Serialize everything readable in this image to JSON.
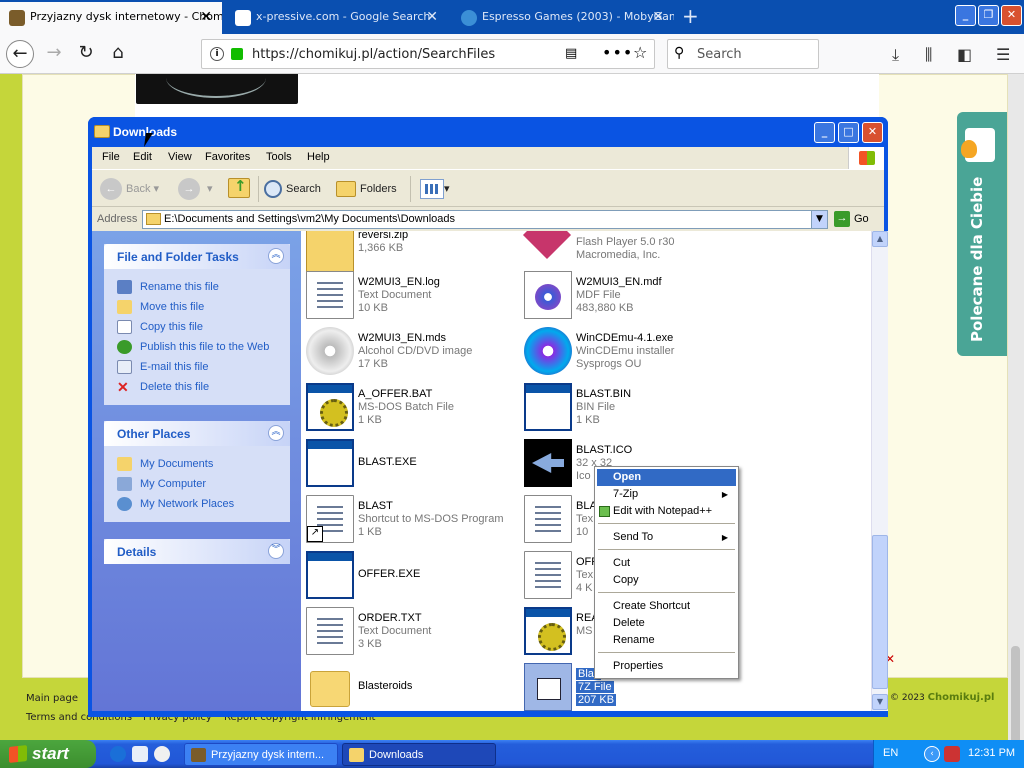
{
  "browser": {
    "tabs": [
      {
        "title": "Przyjazny dysk internetowy - Chomikuj.pl",
        "active": true,
        "favicon_color": "#7a5c2a"
      },
      {
        "title": "x-pressive.com - Google Search",
        "active": false,
        "favicon_color": "#4285f4"
      },
      {
        "title": "Espresso Games (2003) - MobyGames",
        "active": false,
        "favicon_color": "#3b8fd6"
      }
    ],
    "url": "https://chomikuj.pl/action/SearchFiles",
    "search_placeholder": "Search"
  },
  "website": {
    "footer_links": [
      "Main page",
      "Terms and conditions",
      "Privacy policy",
      "Report copyright infringement"
    ],
    "copyright": "© 2023",
    "brand": "Chomikuj.pl",
    "side_tab": "Polecane dla Ciebie"
  },
  "explorer": {
    "title": "Downloads",
    "menu": [
      "File",
      "Edit",
      "View",
      "Favorites",
      "Tools",
      "Help"
    ],
    "toolbar": {
      "back": "Back",
      "search": "Search",
      "folders": "Folders"
    },
    "address_label": "Address",
    "address": "E:\\Documents and Settings\\vm2\\My Documents\\Downloads",
    "go": "Go",
    "file_tasks": {
      "title": "File and Folder Tasks",
      "items": [
        {
          "label": "Rename this file",
          "icon": "rename-icon"
        },
        {
          "label": "Move this file",
          "icon": "move-icon"
        },
        {
          "label": "Copy this file",
          "icon": "copy-icon"
        },
        {
          "label": "Publish this file to the Web",
          "icon": "globe-icon"
        },
        {
          "label": "E-mail this file",
          "icon": "email-icon"
        },
        {
          "label": "Delete this file",
          "icon": "delete-icon"
        }
      ]
    },
    "other_places": {
      "title": "Other Places",
      "items": [
        {
          "label": "My Documents",
          "icon": "folder-icon"
        },
        {
          "label": "My Computer",
          "icon": "computer-icon"
        },
        {
          "label": "My Network Places",
          "icon": "network-icon"
        }
      ]
    },
    "details": {
      "title": "Details"
    },
    "files_left": [
      {
        "name": "reversi.zip",
        "type": "",
        "size": "1,366 KB",
        "icon": "zip"
      },
      {
        "name": "W2MUI3_EN.log",
        "type": "Text Document",
        "size": "10 KB",
        "icon": "doc"
      },
      {
        "name": "W2MUI3_EN.mds",
        "type": "Alcohol CD/DVD image",
        "size": "17 KB",
        "icon": "cd"
      },
      {
        "name": "A_OFFER.BAT",
        "type": "MS-DOS Batch File",
        "size": "1 KB",
        "icon": "bat"
      },
      {
        "name": "BLAST.EXE",
        "type": "",
        "size": "",
        "icon": "window"
      },
      {
        "name": "BLAST",
        "type": "Shortcut to MS-DOS Program",
        "size": "1 KB",
        "icon": "shortcut"
      },
      {
        "name": "OFFER.EXE",
        "type": "",
        "size": "",
        "icon": "window"
      },
      {
        "name": "ORDER.TXT",
        "type": "Text Document",
        "size": "3 KB",
        "icon": "doc"
      },
      {
        "name": "Blasteroids",
        "type": "",
        "size": "",
        "icon": "folder"
      }
    ],
    "files_right": [
      {
        "name": "",
        "type": "Flash Player 5.0 r30",
        "size": "Macromedia, Inc.",
        "icon": "flash"
      },
      {
        "name": "W2MUI3_EN.mdf",
        "type": "MDF File",
        "size": "483,880 KB",
        "icon": "mdf"
      },
      {
        "name": "WinCDEmu-4.1.exe",
        "type": "WinCDEmu installer",
        "size": "Sysprogs OU",
        "icon": "disc"
      },
      {
        "name": "BLAST.BIN",
        "type": "BIN File",
        "size": "1 KB",
        "icon": "window"
      },
      {
        "name": "BLAST.ICO",
        "type": "32 x 32",
        "size": "Ico",
        "icon": "ico"
      },
      {
        "name": "BLA",
        "type": "Tex",
        "size": "10",
        "icon": "doc"
      },
      {
        "name": "OFF",
        "type": "Tex",
        "size": "4 K",
        "icon": "doc"
      },
      {
        "name": "REA",
        "type": "MS",
        "size": "",
        "icon": "bat"
      },
      {
        "name": "Blas",
        "type": "7Z File",
        "size": "207 KB",
        "icon": "7z",
        "selected": true
      }
    ]
  },
  "context_menu": {
    "items": [
      {
        "label": "Open",
        "highlighted": true
      },
      {
        "label": "7-Zip",
        "submenu": true
      },
      {
        "label": "Edit with Notepad++",
        "icon": true
      },
      {
        "separator": true
      },
      {
        "label": "Send To",
        "submenu": true
      },
      {
        "separator": true
      },
      {
        "label": "Cut"
      },
      {
        "label": "Copy"
      },
      {
        "separator": true
      },
      {
        "label": "Create Shortcut"
      },
      {
        "label": "Delete"
      },
      {
        "label": "Rename"
      },
      {
        "separator": true
      },
      {
        "label": "Properties"
      }
    ]
  },
  "taskbar": {
    "start": "start",
    "tasks": [
      {
        "label": "Przyjazny dysk intern...",
        "active": false
      },
      {
        "label": "Downloads",
        "active": true
      }
    ],
    "language": "EN",
    "clock": "12:31 PM"
  }
}
